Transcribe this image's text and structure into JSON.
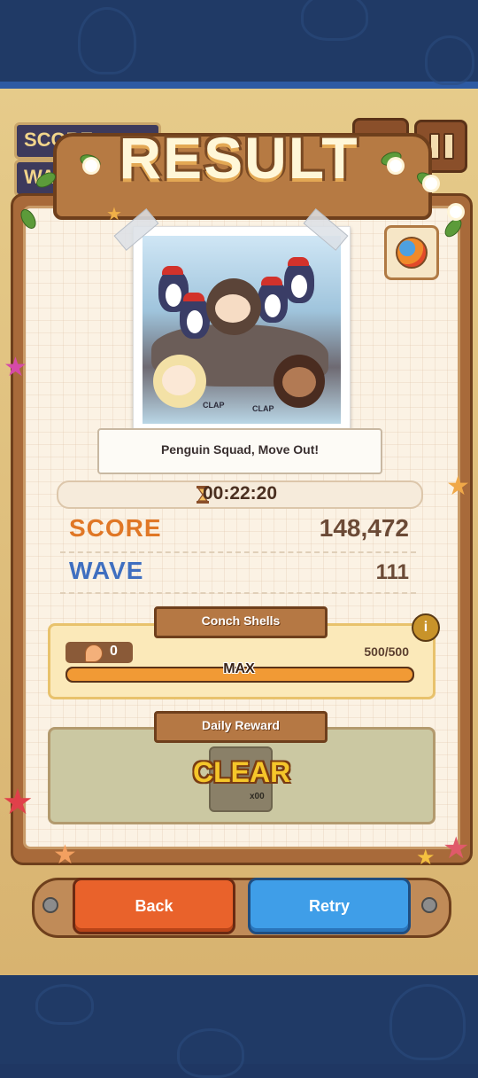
{
  "hud": {
    "score_label": "SCORE",
    "wave_label": "WA"
  },
  "header": {
    "title": "RESULT"
  },
  "photo": {
    "clap_left": "CLAP",
    "clap_right": "CLAP"
  },
  "caption": "Penguin Squad, Move Out!",
  "timer": {
    "value": "00:22:20",
    "icon": "hourglass-icon"
  },
  "stats": {
    "score_label": "SCORE",
    "score_value": "148,472",
    "wave_label": "WAVE",
    "wave_value": "111"
  },
  "conch": {
    "header": "Conch Shells",
    "count": "0",
    "progress_text": "500/500",
    "progress_fraction": 1.0,
    "max_label": "MAX",
    "info_label": "i"
  },
  "daily": {
    "header": "Daily Reward",
    "status": "CLEAR",
    "multiplier": "x00"
  },
  "buttons": {
    "back": "Back",
    "retry": "Retry"
  },
  "colors": {
    "score_label": "#e07726",
    "wave_label": "#3f6fc0",
    "back_button": "#e9622b",
    "retry_button": "#3f9ee8",
    "progress_fill": "#f19a35"
  }
}
